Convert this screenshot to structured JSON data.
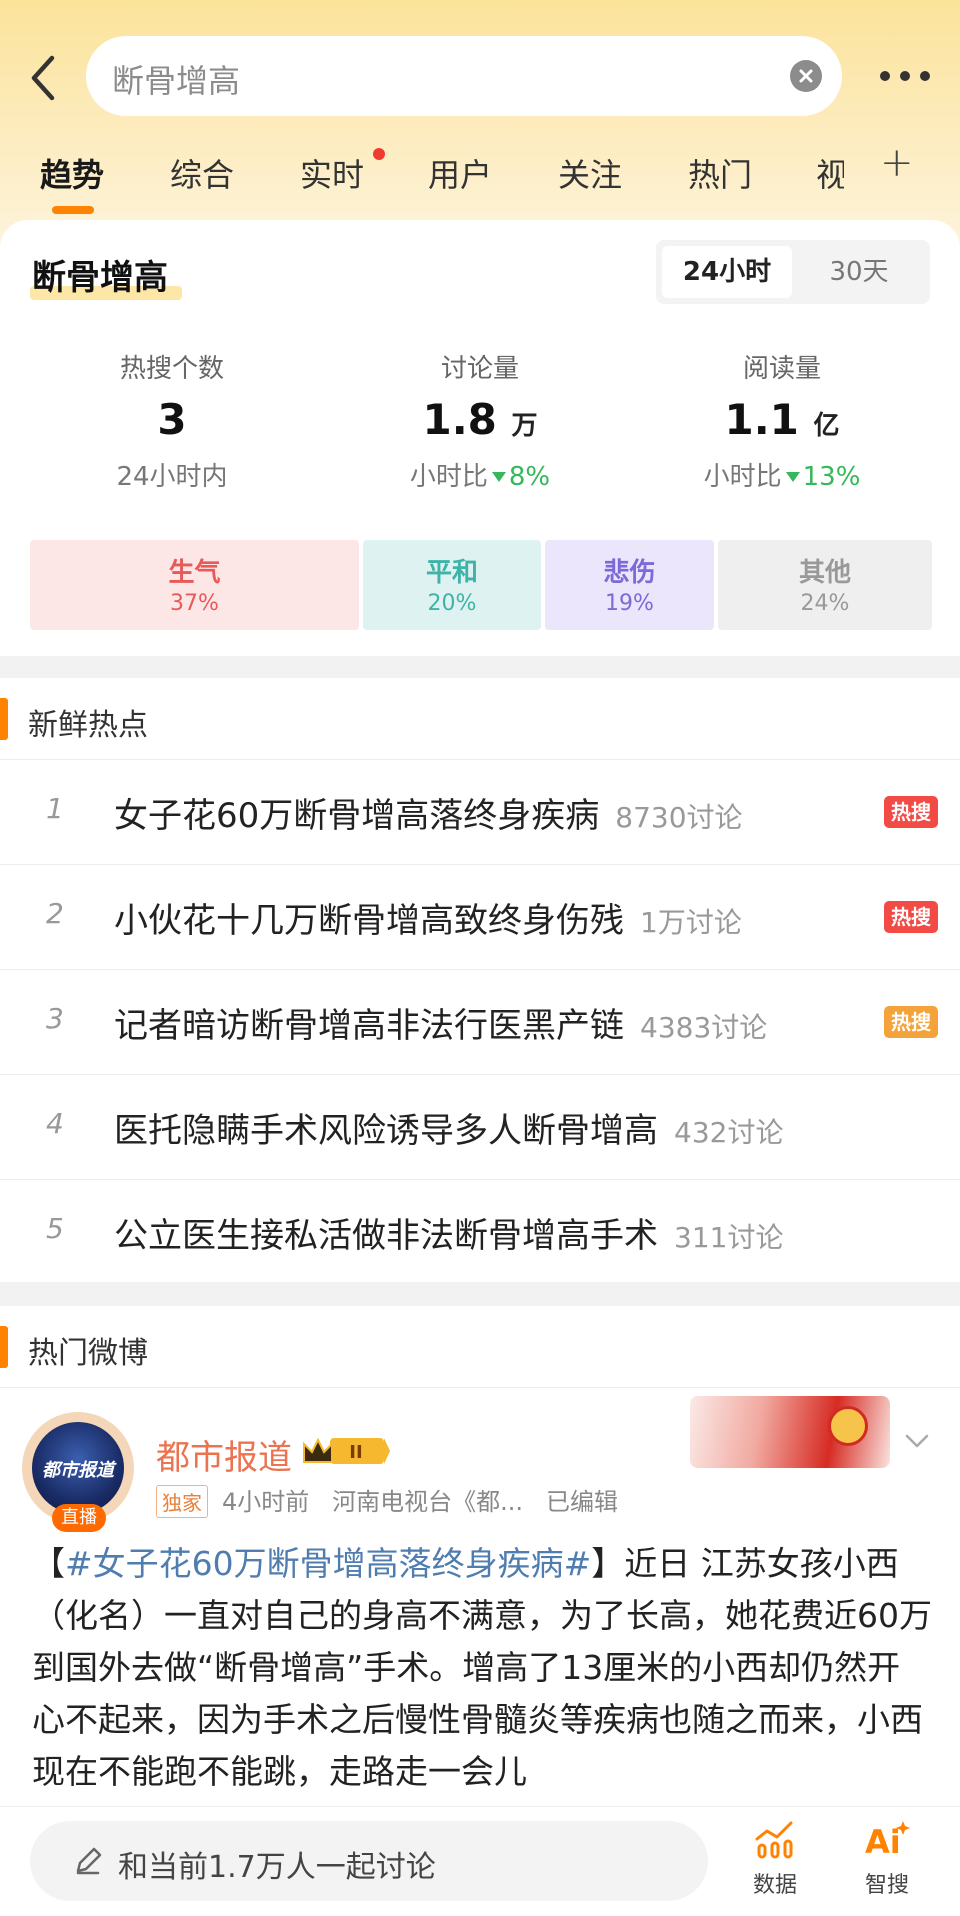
{
  "search": {
    "query": "断骨增高"
  },
  "tabs": [
    {
      "label": "趋势",
      "active": true
    },
    {
      "label": "综合"
    },
    {
      "label": "实时",
      "has_dot": true
    },
    {
      "label": "用户"
    },
    {
      "label": "关注"
    },
    {
      "label": "热门"
    },
    {
      "label": "视"
    }
  ],
  "overview": {
    "topic": "断骨增高",
    "range_options": [
      "24小时",
      "30天"
    ],
    "range_selected": "24小时",
    "stats": [
      {
        "label": "热搜个数",
        "value": "3",
        "unit": "",
        "sub": "24小时内",
        "change": ""
      },
      {
        "label": "讨论量",
        "value": "1.8",
        "unit": "万",
        "sub": "小时比",
        "change": "8%",
        "direction": "down"
      },
      {
        "label": "阅读量",
        "value": "1.1",
        "unit": "亿",
        "sub": "小时比",
        "change": "13%",
        "direction": "down"
      }
    ],
    "emotions": [
      {
        "label": "生气",
        "pct": "37%",
        "color": "#e85a5a",
        "bg": "#fde6e6"
      },
      {
        "label": "平和",
        "pct": "20%",
        "color": "#3fb3a8",
        "bg": "#def3f1"
      },
      {
        "label": "悲伤",
        "pct": "19%",
        "color": "#7d6ad6",
        "bg": "#ebe6fb"
      },
      {
        "label": "其他",
        "pct": "24%",
        "color": "#999999",
        "bg": "#efefef"
      }
    ]
  },
  "fresh": {
    "title": "新鲜热点",
    "items": [
      {
        "rank": "1",
        "title": "女子花60万断骨增高落终身疾病",
        "count": "8730讨论",
        "badge": "热搜",
        "badge_color": "#f24b45"
      },
      {
        "rank": "2",
        "title": "小伙花十几万断骨增高致终身伤残",
        "count": "1万讨论",
        "badge": "热搜",
        "badge_color": "#f24b45"
      },
      {
        "rank": "3",
        "title": "记者暗访断骨增高非法行医黑产链",
        "count": "4383讨论",
        "badge": "热搜",
        "badge_color": "#f4a23a"
      },
      {
        "rank": "4",
        "title": "医托隐瞒手术风险诱导多人断骨增高",
        "count": "432讨论",
        "badge": "",
        "badge_color": ""
      },
      {
        "rank": "5",
        "title": "公立医生接私活做非法断骨增高手术",
        "count": "311讨论",
        "badge": "",
        "badge_color": ""
      }
    ]
  },
  "hot": {
    "title": "热门微博",
    "post": {
      "avatar_text": "都市报道",
      "live_label": "直播",
      "author": "都市报道",
      "level": "II",
      "tag": "独家",
      "time": "4小时前",
      "source": "河南电视台《都...",
      "edited": "已编辑",
      "hashtag": "#女子花60万断骨增高落终身疾病#",
      "body": "近日 江苏女孩小西（化名）一直对自己的身高不满意，为了长高，她花费近60万到国外去做“断骨增高”手术。增高了13厘米的小西却仍然开心不起来，因为手术之后慢性骨髓炎等疾病也随之而来，小西现在不能跑不能跳，走路走一会儿"
    }
  },
  "bottom": {
    "discuss_placeholder": "和当前1.7万人一起讨论",
    "tools": [
      {
        "label": "数据",
        "icon": "chart-icon"
      },
      {
        "label": "智搜",
        "icon": "ai-icon"
      }
    ]
  }
}
